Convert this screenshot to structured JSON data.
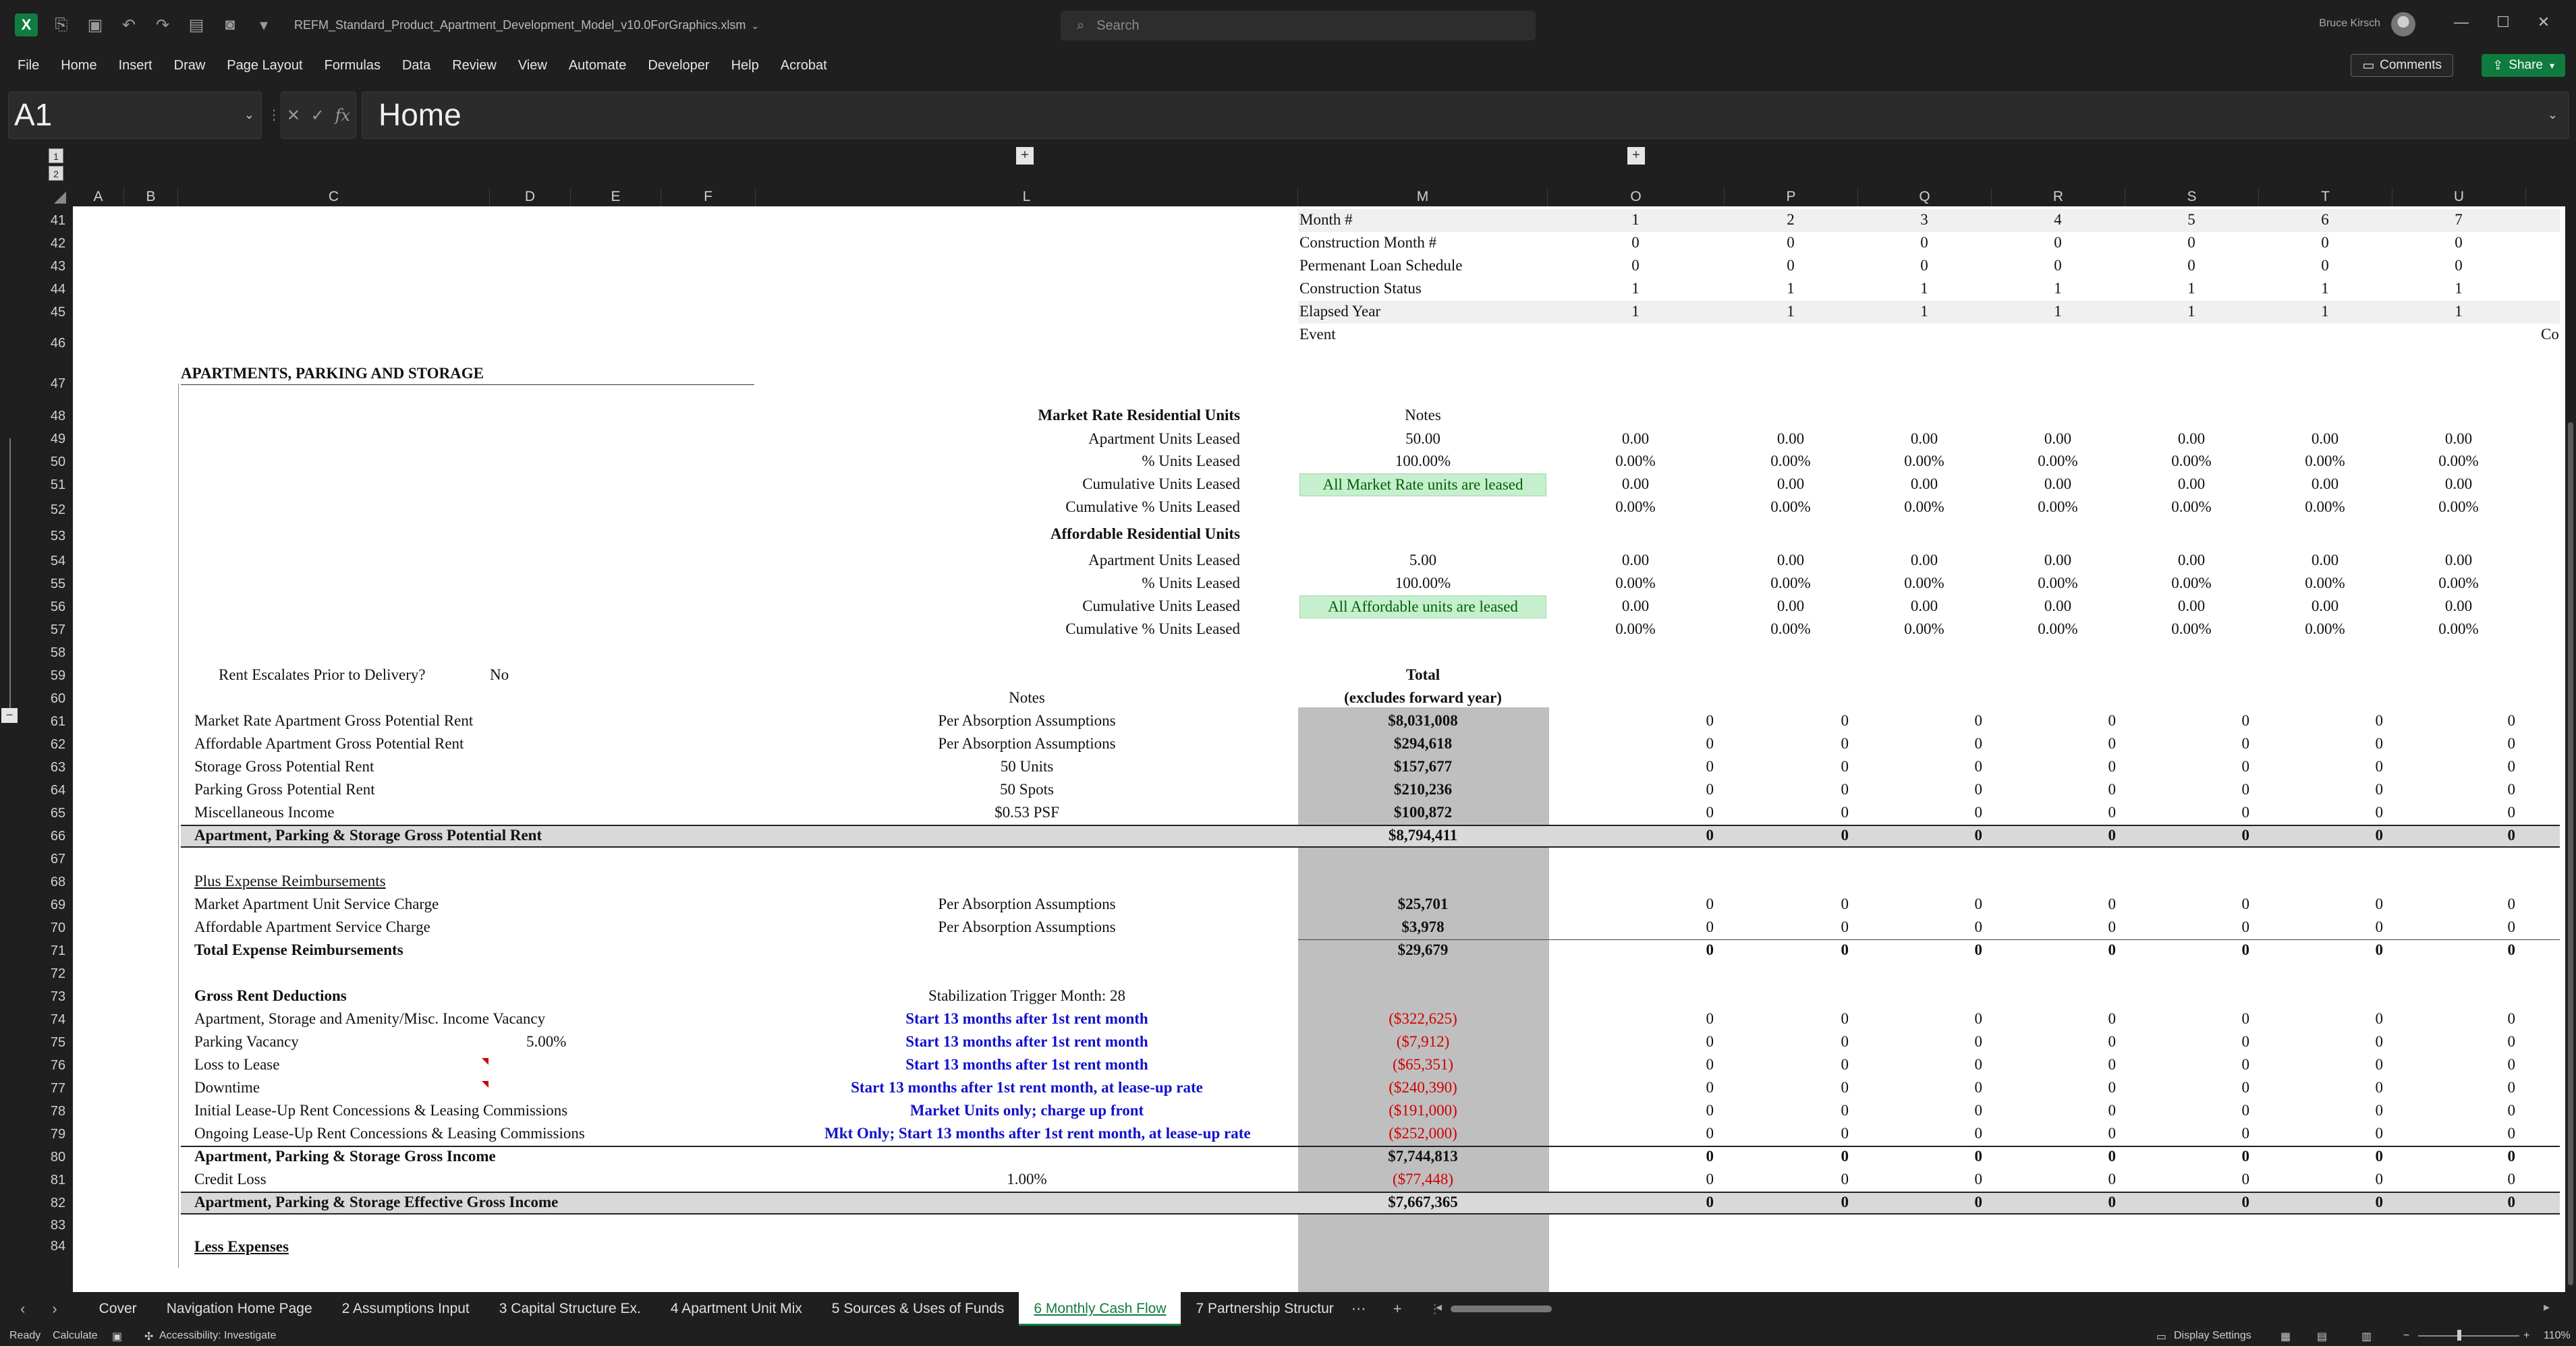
{
  "app": {
    "file_name": "REFM_Standard_Product_Apartment_Development_Model_v10.0ForGraphics.xlsm",
    "search_placeholder": "Search",
    "user_name": "Bruce Kirsch",
    "accent": "#107c41"
  },
  "menu": [
    "File",
    "Home",
    "Insert",
    "Draw",
    "Page Layout",
    "Formulas",
    "Data",
    "Review",
    "View",
    "Automate",
    "Developer",
    "Help",
    "Acrobat"
  ],
  "buttons": {
    "comments": "Comments",
    "share": "Share"
  },
  "formula_bar": {
    "name_box": "A1",
    "formula": "Home",
    "fx": "fx"
  },
  "outline_levels": [
    "1",
    "2"
  ],
  "columns": [
    "A",
    "B",
    "C",
    "D",
    "E",
    "F",
    "L",
    "M",
    "O",
    "P",
    "Q",
    "R",
    "S",
    "T",
    "U"
  ],
  "rows": [
    "41",
    "42",
    "43",
    "44",
    "45",
    "46",
    "47",
    "48",
    "49",
    "50",
    "51",
    "52",
    "53",
    "54",
    "55",
    "56",
    "57",
    "58",
    "59",
    "60",
    "61",
    "62",
    "63",
    "64",
    "65",
    "66",
    "67",
    "68",
    "69",
    "70",
    "71",
    "72",
    "73",
    "74",
    "75",
    "76",
    "77",
    "78",
    "79",
    "80",
    "81",
    "82",
    "83",
    "84"
  ],
  "timeline": {
    "labels": [
      "Month #",
      "Construction Month #",
      "Permenant Loan Schedule",
      "Construction Status",
      "Elapsed Year",
      "Event"
    ],
    "values": [
      [
        "1",
        "2",
        "3",
        "4",
        "5",
        "6",
        "7"
      ],
      [
        "0",
        "0",
        "0",
        "0",
        "0",
        "0",
        "0"
      ],
      [
        "0",
        "0",
        "0",
        "0",
        "0",
        "0",
        "0"
      ],
      [
        "1",
        "1",
        "1",
        "1",
        "1",
        "1",
        "1"
      ],
      [
        "1",
        "1",
        "1",
        "1",
        "1",
        "1",
        "1"
      ]
    ],
    "event_overflow": "Co"
  },
  "apartments": {
    "section_title": "APARTMENTS, PARKING AND STORAGE",
    "market_header": "Market Rate Residential Units",
    "notes_header": "Notes",
    "market_rows": [
      {
        "label": "Apartment Units Leased",
        "m": "50.00",
        "vals": [
          "0.00",
          "0.00",
          "0.00",
          "0.00",
          "0.00",
          "0.00",
          "0.00"
        ]
      },
      {
        "label": "% Units Leased",
        "m": "100.00%",
        "vals": [
          "0.00%",
          "0.00%",
          "0.00%",
          "0.00%",
          "0.00%",
          "0.00%",
          "0.00%"
        ]
      },
      {
        "label": "Cumulative Units Leased",
        "m": "All Market Rate units are leased",
        "vals": [
          "0.00",
          "0.00",
          "0.00",
          "0.00",
          "0.00",
          "0.00",
          "0.00"
        ]
      },
      {
        "label": "Cumulative % Units Leased",
        "m": "",
        "vals": [
          "0.00%",
          "0.00%",
          "0.00%",
          "0.00%",
          "0.00%",
          "0.00%",
          "0.00%"
        ]
      }
    ],
    "affordable_header": "Affordable Residential Units",
    "affordable_rows": [
      {
        "label": "Apartment Units Leased",
        "m": "5.00",
        "vals": [
          "0.00",
          "0.00",
          "0.00",
          "0.00",
          "0.00",
          "0.00",
          "0.00"
        ]
      },
      {
        "label": "% Units Leased",
        "m": "100.00%",
        "vals": [
          "0.00%",
          "0.00%",
          "0.00%",
          "0.00%",
          "0.00%",
          "0.00%",
          "0.00%"
        ]
      },
      {
        "label": "Cumulative Units Leased",
        "m": "All Affordable units are leased",
        "vals": [
          "0.00",
          "0.00",
          "0.00",
          "0.00",
          "0.00",
          "0.00",
          "0.00"
        ]
      },
      {
        "label": "Cumulative % Units Leased",
        "m": "",
        "vals": [
          "0.00%",
          "0.00%",
          "0.00%",
          "0.00%",
          "0.00%",
          "0.00%",
          "0.00%"
        ]
      }
    ]
  },
  "rent": {
    "escalates_label": "Rent Escalates Prior to Delivery?",
    "escalates_value": "No",
    "total_header_1": "Total",
    "total_header_2": "(excludes forward year)",
    "notes_header": "Notes",
    "gpr_rows": [
      {
        "label": "Market Rate Apartment Gross Potential Rent",
        "note": "Per Absorption Assumptions",
        "total": "$8,031,008"
      },
      {
        "label": "Affordable Apartment Gross Potential Rent",
        "note": "Per Absorption Assumptions",
        "total": "$294,618"
      },
      {
        "label": "Storage Gross Potential Rent",
        "note": "50 Units",
        "total": "$157,677"
      },
      {
        "label": "Parking Gross Potential Rent",
        "note": "50 Spots",
        "total": "$210,236"
      },
      {
        "label": "Miscellaneous Income",
        "note": "$0.53 PSF",
        "total": "$100,872"
      }
    ],
    "gpr_total": {
      "label": "Apartment, Parking & Storage Gross Potential Rent",
      "total": "$8,794,411"
    },
    "reimb_header": "Plus Expense Reimbursements",
    "reimb_rows": [
      {
        "label": "Market Apartment Unit Service Charge",
        "note": "Per Absorption Assumptions",
        "total": "$25,701"
      },
      {
        "label": "Affordable Apartment Service Charge",
        "note": "Per Absorption Assumptions",
        "total": "$3,978"
      }
    ],
    "reimb_total": {
      "label": "Total Expense Reimbursements",
      "total": "$29,679"
    },
    "deduct_header": "Gross Rent Deductions",
    "stabilization": "Stabilization Trigger Month: 28",
    "deduct_rows": [
      {
        "label": "Apartment, Storage and Amenity/Misc. Income Vacancy",
        "d": "",
        "note": "Start 13 months after 1st rent month",
        "total": "($322,625)"
      },
      {
        "label": "Parking Vacancy",
        "d": "5.00%",
        "note": "Start 13 months after 1st rent month",
        "total": "($7,912)"
      },
      {
        "label": "Loss to Lease",
        "d": "",
        "note": "Start 13 months after 1st rent month",
        "total": "($65,351)"
      },
      {
        "label": "Downtime",
        "d": "",
        "note": "Start 13 months after 1st rent month, at lease-up rate",
        "total": "($240,390)"
      },
      {
        "label": "Initial Lease-Up Rent Concessions & Leasing Commissions",
        "d": "",
        "note": "Market Units only; charge up front",
        "total": "($191,000)"
      },
      {
        "label": "Ongoing Lease-Up Rent Concessions & Leasing Commissions",
        "d": "",
        "note": "Mkt Only; Start 13 months after 1st rent month, at lease-up rate",
        "total": "($252,000)"
      }
    ],
    "gross_income": {
      "label": "Apartment, Parking & Storage Gross Income",
      "total": "$7,744,813"
    },
    "credit_loss": {
      "label": "Credit Loss",
      "note": "1.00%",
      "total": "($77,448)"
    },
    "egi": {
      "label": "Apartment, Parking & Storage Effective Gross Income",
      "total": "$7,667,365"
    },
    "next_header": "Less Expenses",
    "zero": "0"
  },
  "sheet_tabs": [
    "Cover",
    "Navigation Home Page",
    "2 Assumptions Input",
    "3 Capital Structure Ex.",
    "4 Apartment Unit Mix",
    "5 Sources & Uses of Funds",
    "6 Monthly Cash Flow",
    "7 Partnership Structur"
  ],
  "active_tab": "6 Monthly Cash Flow",
  "status": {
    "ready": "Ready",
    "calculate": "Calculate",
    "accessibility": "Accessibility: Investigate",
    "display_settings": "Display Settings",
    "zoom": "110%"
  }
}
